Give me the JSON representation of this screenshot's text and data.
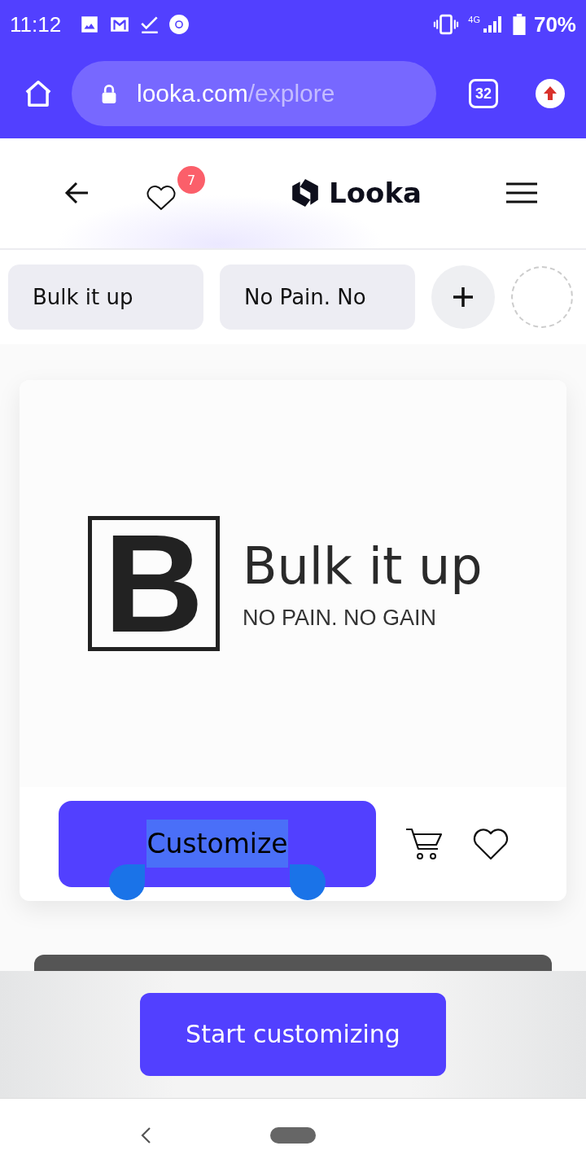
{
  "status_bar": {
    "time": "11:12",
    "network": "4G",
    "battery": "70%"
  },
  "browser": {
    "url_host": "looka.com",
    "url_path": "/explore",
    "tab_count": "32"
  },
  "header": {
    "favorites_badge": "7",
    "logo": "Looka"
  },
  "chips": [
    {
      "label": "Bulk it up"
    },
    {
      "label": "No Pain. No"
    }
  ],
  "card": {
    "logo_letter": "B",
    "name": "Bulk it up",
    "tagline": "NO PAIN. NO GAIN",
    "button": {
      "label": "Customize",
      "text_selected": true
    }
  },
  "cta": "Start customizing"
}
